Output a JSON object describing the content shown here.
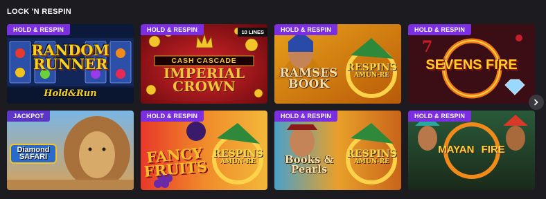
{
  "section": {
    "title": "LOCK 'N RESPIN"
  },
  "badges": {
    "hold": "HOLD & RESPIN",
    "jackpot": "JACKPOT",
    "ten_lines": "10 LINES"
  },
  "games": [
    {
      "title_line1": "RANDOM",
      "title_line2": "RUNNER",
      "subtitle": "Hold&Run"
    },
    {
      "top_label": "CASH CASCADE",
      "title_line1": "IMPERIAL",
      "title_line2": "CROWN"
    },
    {
      "title_line1": "RAMSES",
      "title_line2": "BOOK",
      "respins_top": "RESPINS",
      "respins_bottom": "AMUN-RE"
    },
    {
      "title_line1": "SEVENS FIRE"
    },
    {
      "title_line1": "Diamond",
      "title_line2": "SAFARI"
    },
    {
      "title_line1": "FANCY",
      "title_line2": "FRUITS",
      "respins_top": "RESPINS",
      "respins_bottom": "AMUN-RE"
    },
    {
      "title_line1": "Books &",
      "title_line2": "Pearls",
      "respins_top": "RESPINS",
      "respins_bottom": "AMUN-RE"
    },
    {
      "title_line1": "MAYAN",
      "title_line2": "FIRE"
    }
  ],
  "icons": {
    "next": "chevron-right-icon"
  },
  "colors": {
    "background": "#1c1b20",
    "badge_hold": "#7b2fe0",
    "badge_jackpot": "#5d35c9"
  }
}
